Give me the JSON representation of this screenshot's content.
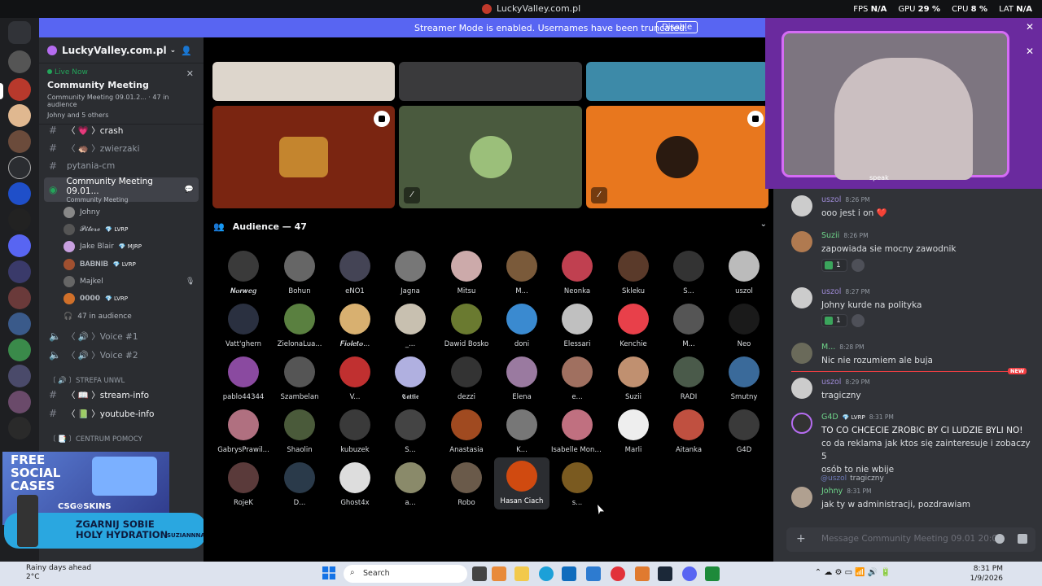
{
  "window": {
    "title": "LuckyValley.com.pl"
  },
  "perf": {
    "fps_label": "FPS",
    "fps_value": "N/A",
    "gpu_label": "GPU",
    "gpu_value": "29 %",
    "cpu_label": "CPU",
    "cpu_value": "8 %",
    "lat_label": "LAT",
    "lat_value": "N/A"
  },
  "banner": {
    "text": "Streamer Mode is enabled. Usernames have been truncated.",
    "button": "Disable"
  },
  "sidebar": {
    "server_name": "LuckyValley.com.pl",
    "live": {
      "label": "Live Now",
      "title": "Community Meeting",
      "meta": "Community Meeting 09.01.2...  ·  47 in audience",
      "users": "Johny and 5 others"
    },
    "channels": [
      {
        "name": "〈 💗 〉crash"
      },
      {
        "name": "〈 🦔 〉zwierzaki"
      },
      {
        "name": "pytania-cm"
      }
    ],
    "stage_channel": {
      "name": "Community Meeting 09.01...",
      "sub": "Community Meeting"
    },
    "voice_users": [
      {
        "name": "Johny",
        "tag": ""
      },
      {
        "name": "𝓟𝓲𝓽𝓮𝓻𝓸",
        "tag": "💎 LVRP"
      },
      {
        "name": "Jake Blair",
        "tag": "💎 MJRP"
      },
      {
        "name": "𝐁𝐀𝐁𝐍𝐈𝐁",
        "tag": "💎 LVRP"
      },
      {
        "name": "Majkel",
        "tag": ""
      },
      {
        "name": "𝟬𝟬𝟬𝟬",
        "tag": "💎 LVRP"
      }
    ],
    "audience_count": "47 in audience",
    "voice_channels": [
      {
        "name": "〈 🔊 〉Voice #1"
      },
      {
        "name": "〈 🔊 〉Voice #2"
      }
    ],
    "categories": [
      {
        "name": "〔 🔊 〕STREFA UNWL"
      },
      {
        "name": "〔 📑 〕CENTRUM POMOCY"
      }
    ],
    "text_channels": [
      {
        "name": "〈 📖 〉stream-info"
      },
      {
        "name": "〈 📗 〉youtube-info"
      }
    ]
  },
  "ads": {
    "free_social_cases": "FREE\nSOCIAL\nCASES",
    "csgo_skins": "CSG⊙SKINS",
    "hydration": "ZGARNIJ SOBIE\nHOLY HYDRATION",
    "hydration_brand": "SUZIANNNA"
  },
  "stage": {
    "audience_header": "Audience — 47",
    "members": [
      "𝑵𝒐𝒓𝒘𝒆𝒈",
      "Bohun",
      "eNO1",
      "Jagna",
      "Mitsu",
      "M...",
      "Neonka",
      "Skleku",
      "S...",
      "uszol",
      "Vatt'ghern",
      "ZielonaLua...",
      "𝑭𝒊𝒐𝒍𝒆𝒕𝒐...",
      "_...",
      "Dawid Bosko",
      "doni",
      "Elessari",
      "Kenchie",
      "M...",
      "Neo",
      "pablo44344",
      "Szambelan",
      "V...",
      "𝕮𝖆𝖙𝖙𝖎𝖊",
      "dezzi",
      "Elena",
      "e...",
      "Suzii",
      "RADI",
      "Smutny",
      "GabrysPrawil...",
      "Shaolin",
      "kubuzek",
      "S...",
      "Anastasia",
      "K...",
      "Isabelle Monti...",
      "Marli",
      "Aitanka",
      "G4D",
      "RojeK",
      "D...",
      "Ghost4x",
      "a...",
      "Robo",
      "Hasan Ciach",
      "s..."
    ]
  },
  "chat": {
    "messages": [
      {
        "user": "uszol",
        "time": "8:26 PM",
        "text": "ooo jest i on ❤️",
        "color": "#9d8ad6"
      },
      {
        "user": "Suzii",
        "time": "8:26 PM",
        "text": "zapowiada sie mocny zawodnik",
        "reaction": "1",
        "color": "#6fd68a"
      },
      {
        "user": "uszol",
        "time": "8:27 PM",
        "text": "Johny kurde na polityka",
        "reaction": "1",
        "color": "#9d8ad6"
      },
      {
        "user": "M...",
        "time": "8:28 PM",
        "text": "Nic nie rozumiem ale buja",
        "color": "#6fd68a"
      },
      {
        "user": "uszol",
        "time": "8:29 PM",
        "text": "tragiczny",
        "color": "#9d8ad6"
      },
      {
        "user": "G4D",
        "tag": "💎 LVRP",
        "time": "8:31 PM",
        "text": "TO CO CHCECIE ZROBIC BY CI LUDZIE BYLI NO!",
        "text2": "co da reklama jak ktos się zainteresuje i zobaczy 5",
        "text3": "osób to nie wbije",
        "color": "#6fd68a"
      },
      {
        "user": "Johny",
        "time": "8:31 PM",
        "text": "jak ty w administracji, pozdrawiam",
        "color": "#6fd68a"
      }
    ],
    "reply_user": "@uszol",
    "reply_text": "tragiczny",
    "new_label": "NEW",
    "placeholder": "Message Community Meeting 09.01 20:00",
    "webcam_text": "speak"
  },
  "taskbar": {
    "weather_title": "Rainy days ahead",
    "weather_temp": "2°C",
    "search": "Search",
    "time": "8:31 PM",
    "date": "1/9/2026"
  }
}
